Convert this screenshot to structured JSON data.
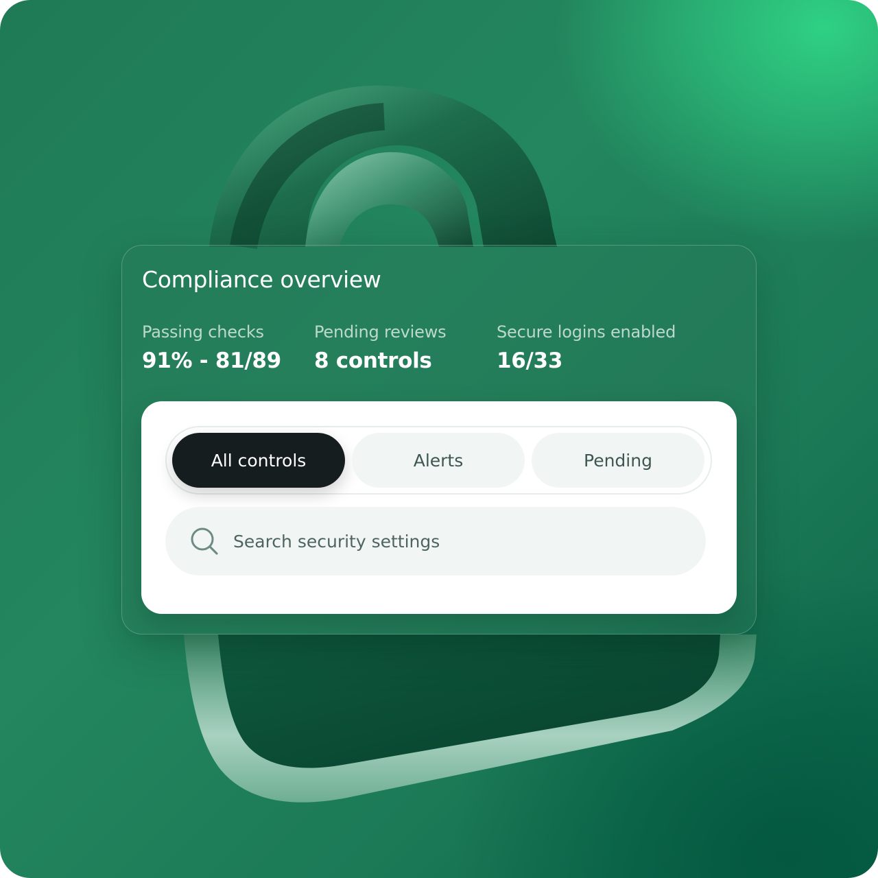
{
  "panel": {
    "title": "Compliance overview",
    "stats": [
      {
        "label": "Passing checks",
        "value": "91% - 81/89"
      },
      {
        "label": "Pending reviews",
        "value": "8 controls"
      },
      {
        "label": "Secure logins enabled",
        "value": "16/33"
      }
    ]
  },
  "filters": {
    "tabs": [
      {
        "label": "All controls",
        "active": true
      },
      {
        "label": "Alerts",
        "active": false
      },
      {
        "label": "Pending",
        "active": false
      }
    ]
  },
  "search": {
    "placeholder": "Search security settings",
    "value": "",
    "icon": "search-icon"
  },
  "colors": {
    "background_green": "#1f7a55",
    "accent_green": "#2fd184",
    "active_tab": "#161d1f",
    "inactive_tab": "#f1f6f5"
  }
}
